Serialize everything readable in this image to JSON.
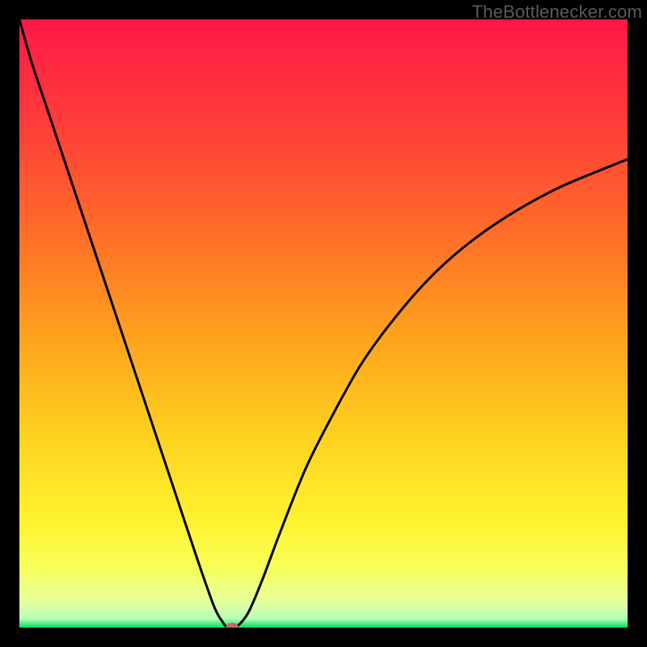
{
  "watermark": {
    "text": "TheBottlenecker.com"
  },
  "chart_data": {
    "type": "line",
    "title": "",
    "xlabel": "",
    "ylabel": "",
    "xlim": [
      0,
      100
    ],
    "ylim": [
      0,
      100
    ],
    "gradient": {
      "stops": [
        {
          "offset": 0,
          "color": "#ff1846"
        },
        {
          "offset": 0.16,
          "color": "#ff3a3a"
        },
        {
          "offset": 0.34,
          "color": "#ff6a2a"
        },
        {
          "offset": 0.52,
          "color": "#ffa21e"
        },
        {
          "offset": 0.68,
          "color": "#ffd020"
        },
        {
          "offset": 0.82,
          "color": "#fff22e"
        },
        {
          "offset": 0.9,
          "color": "#f8ff58"
        },
        {
          "offset": 0.955,
          "color": "#e8ff9a"
        },
        {
          "offset": 0.985,
          "color": "#b8ffb8"
        },
        {
          "offset": 1,
          "color": "#00e060"
        }
      ]
    },
    "curve": {
      "x": [
        0,
        2,
        5,
        8,
        11,
        14,
        17,
        20,
        23,
        26,
        29,
        32,
        33.5,
        34,
        35,
        36,
        37,
        38,
        40,
        43,
        47,
        51,
        56,
        61,
        67,
        73,
        80,
        88,
        95,
        100
      ],
      "y": [
        100,
        93,
        84,
        75,
        66,
        57,
        48,
        39,
        30,
        21,
        12,
        3.5,
        0.8,
        0.2,
        0,
        0.4,
        1.5,
        3.2,
        8,
        16,
        26,
        34,
        43,
        50,
        57,
        62.5,
        67.5,
        72,
        75,
        77
      ]
    },
    "marker": {
      "x": 35,
      "y": 0,
      "rx": 8,
      "ry": 6,
      "fill": "#c46b5f"
    }
  }
}
